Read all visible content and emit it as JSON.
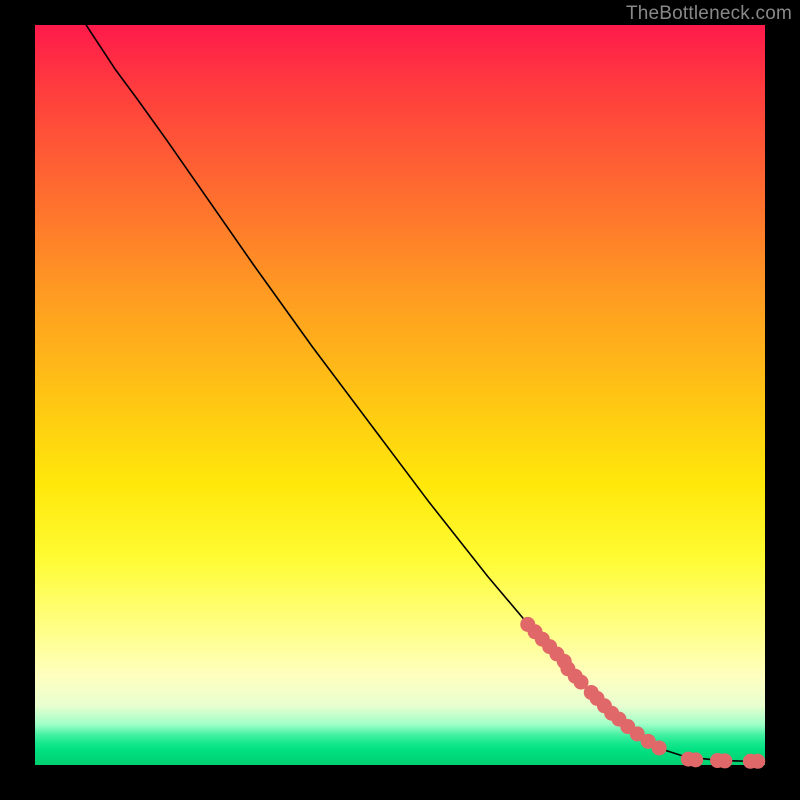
{
  "watermark": "TheBottleneck.com",
  "colors": {
    "frame": "#000000",
    "curve": "#000000",
    "dot": "#e06868"
  },
  "chart_data": {
    "type": "line",
    "title": "",
    "xlabel": "",
    "ylabel": "",
    "xlim": [
      0,
      100
    ],
    "ylim": [
      0,
      100
    ],
    "grid": false,
    "legend": false,
    "series": [
      {
        "name": "curve",
        "x": [
          7,
          9,
          11,
          14,
          18,
          24,
          30,
          38,
          46,
          54,
          62,
          68,
          74,
          79,
          83,
          86,
          88.5,
          91,
          93,
          94.5,
          96,
          97.5,
          98.5,
          99.5,
          100
        ],
        "y": [
          100,
          97,
          94,
          90,
          84.5,
          76,
          67.5,
          56.5,
          46,
          35.5,
          25.5,
          18.5,
          12,
          7,
          3.8,
          2.1,
          1.3,
          0.9,
          0.7,
          0.6,
          0.55,
          0.52,
          0.5,
          0.5,
          0.5
        ]
      }
    ],
    "highlight_dots": {
      "name": "highlighted-points",
      "x": [
        67.5,
        68.5,
        69.5,
        70.5,
        71.5,
        72.5,
        73.0,
        74.0,
        74.8,
        76.2,
        77.0,
        78.0,
        79.0,
        80.0,
        81.2,
        82.5,
        84.0,
        85.5,
        89.5,
        90.5,
        93.5,
        94.5,
        98.0,
        99.0
      ],
      "y": [
        19.0,
        18.0,
        17.0,
        16.0,
        15.0,
        14.0,
        13.0,
        12.0,
        11.2,
        9.8,
        9.0,
        8.0,
        7.0,
        6.2,
        5.2,
        4.2,
        3.2,
        2.3,
        0.8,
        0.7,
        0.6,
        0.55,
        0.5,
        0.5
      ]
    }
  }
}
